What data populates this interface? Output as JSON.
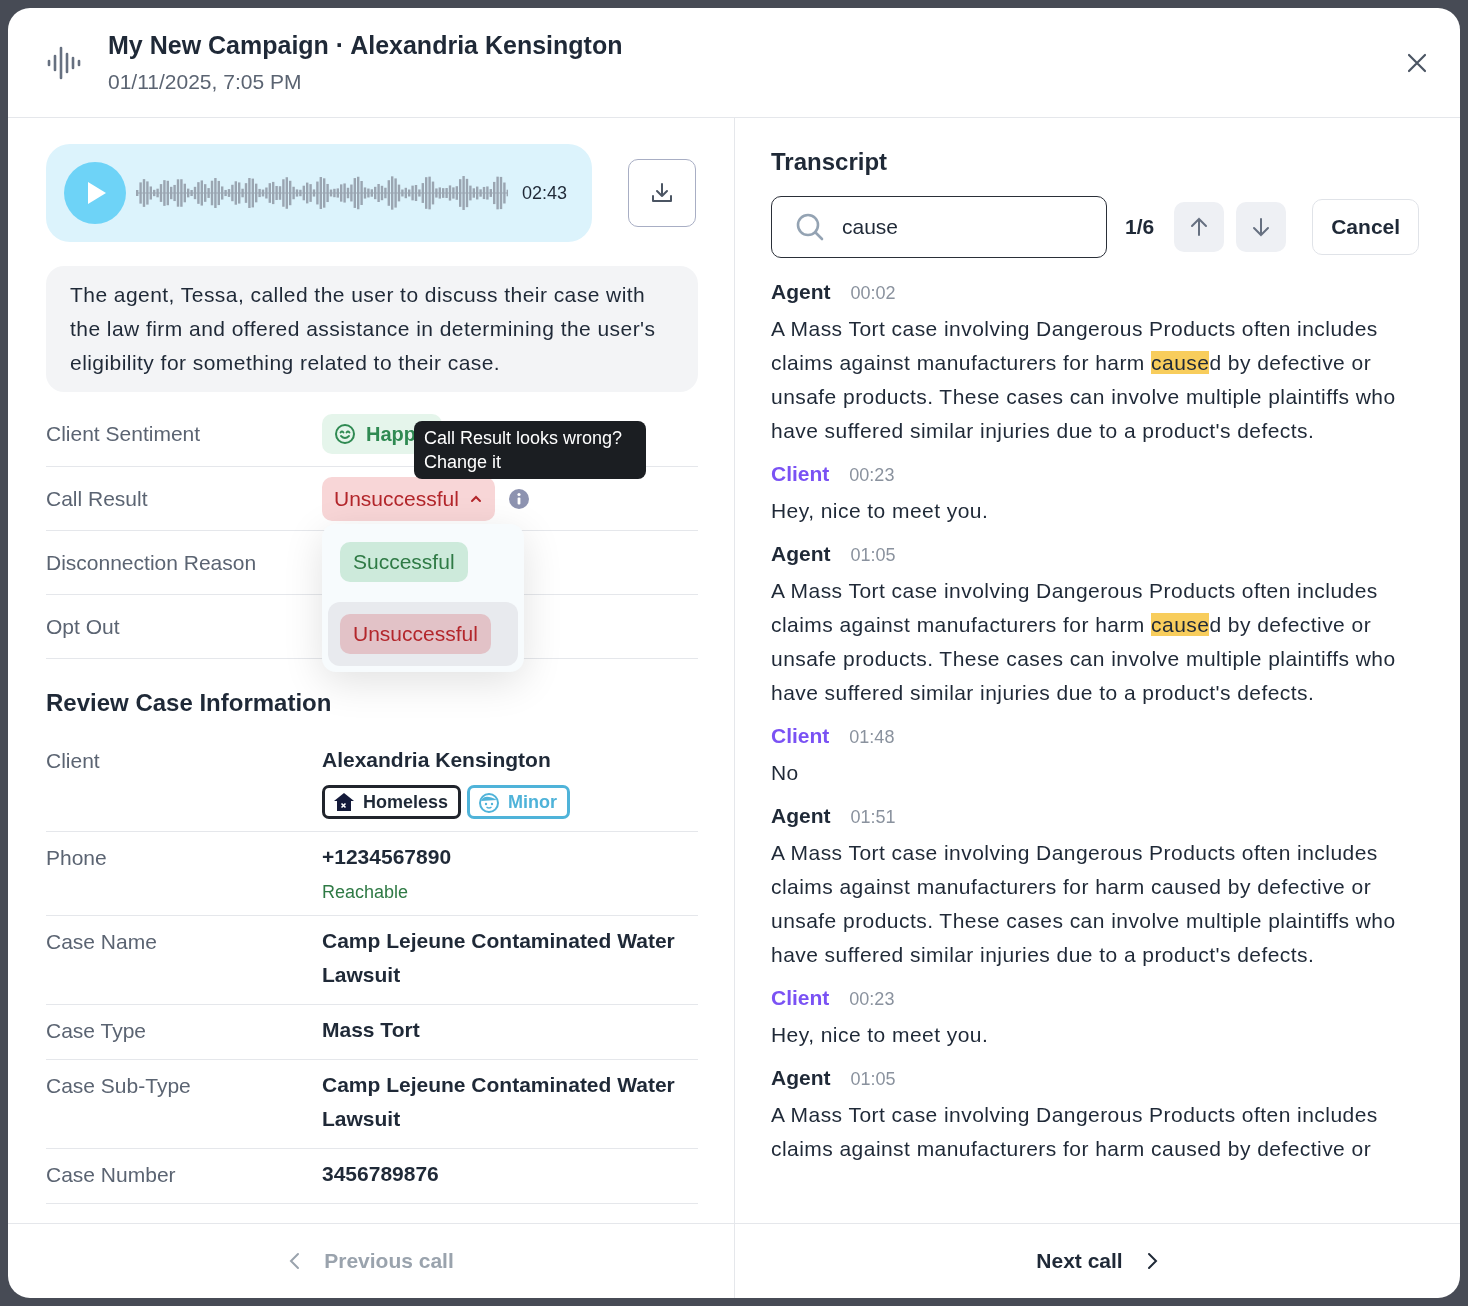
{
  "header": {
    "title": "My New Campaign · Alexandria Kensington",
    "subtitle": "01/11/2025, 7:05 PM"
  },
  "player": {
    "duration": "02:43",
    "playing": false
  },
  "summary": "The agent, Tessa, called the user to discuss their case with the law firm and offered assistance in determining the user's eligibility for something related to their case.",
  "call_fields": [
    {
      "label": "Client Sentiment",
      "kind": "sentiment",
      "value": "Happ"
    },
    {
      "label": "Call Result",
      "kind": "result",
      "value": "Unsuccessful",
      "expanded": true
    },
    {
      "label": "Disconnection Reason",
      "kind": "plain"
    },
    {
      "label": "Opt Out",
      "kind": "plain"
    }
  ],
  "tooltip": "Call Result looks wrong? Change it",
  "result_options": [
    {
      "label": "Successful",
      "kind": "success",
      "selected": false
    },
    {
      "label": "Unsuccessful",
      "kind": "failure",
      "selected": true
    }
  ],
  "review": {
    "title": "Review Case Information",
    "rows": [
      {
        "label": "Client",
        "value": "Alexandria Kensington",
        "tags": [
          {
            "label": "Homeless",
            "kind": "homeless"
          },
          {
            "label": "Minor",
            "kind": "minor"
          }
        ]
      },
      {
        "label": "Phone",
        "value": "+1234567890",
        "note": "Reachable"
      },
      {
        "label": "Case Name",
        "value": "Camp Lejeune Contaminated Water Lawsuit"
      },
      {
        "label": "Case Type",
        "value": "Mass Tort"
      },
      {
        "label": "Case Sub-Type",
        "value": "Camp Lejeune Contaminated Water Lawsuit"
      },
      {
        "label": "Case Number",
        "value": "3456789876"
      }
    ]
  },
  "transcript": {
    "title": "Transcript",
    "search": {
      "value": "cause",
      "count": "1/6"
    },
    "cancel": "Cancel",
    "messages": [
      {
        "speaker": "Agent",
        "kind": "agent",
        "time": "00:02",
        "parts": [
          {
            "text": "A Mass Tort case involving Dangerous Products often includes claims against manufacturers for harm ",
            "highlight": false
          },
          {
            "text": "cause",
            "highlight": true
          },
          {
            "text": "d by defective or unsafe products. These cases can involve multiple plaintiffs who have suffered similar injuries due to a product's defects.",
            "highlight": false
          }
        ]
      },
      {
        "speaker": "Client",
        "kind": "client",
        "time": "00:23",
        "parts": [
          {
            "text": "Hey, nice to meet you.",
            "highlight": false
          }
        ]
      },
      {
        "speaker": "Agent",
        "kind": "agent",
        "time": "01:05",
        "parts": [
          {
            "text": "A Mass Tort case involving Dangerous Products often includes claims against manufacturers for harm ",
            "highlight": false
          },
          {
            "text": "cause",
            "highlight": true
          },
          {
            "text": "d by defective or unsafe products. These cases can involve multiple plaintiffs who have suffered similar injuries due to a product's defects.",
            "highlight": false
          }
        ]
      },
      {
        "speaker": "Client",
        "kind": "client",
        "time": "01:48",
        "parts": [
          {
            "text": "No",
            "highlight": false
          }
        ]
      },
      {
        "speaker": "Agent",
        "kind": "agent",
        "time": "01:51",
        "parts": [
          {
            "text": "A Mass Tort case involving Dangerous Products often includes claims against manufacturers for harm caused by defective or unsafe products. These cases can involve multiple plaintiffs who have suffered similar injuries due to a product's defects.",
            "highlight": false
          }
        ]
      },
      {
        "speaker": "Client",
        "kind": "client",
        "time": "00:23",
        "parts": [
          {
            "text": "Hey, nice to meet you.",
            "highlight": false
          }
        ]
      },
      {
        "speaker": "Agent",
        "kind": "agent",
        "time": "01:05",
        "parts": [
          {
            "text": "A Mass Tort case involving Dangerous Products often includes claims against manufacturers for harm caused by defective or",
            "highlight": false
          }
        ]
      }
    ]
  },
  "footer": {
    "previous": "Previous call",
    "next": "Next call"
  }
}
